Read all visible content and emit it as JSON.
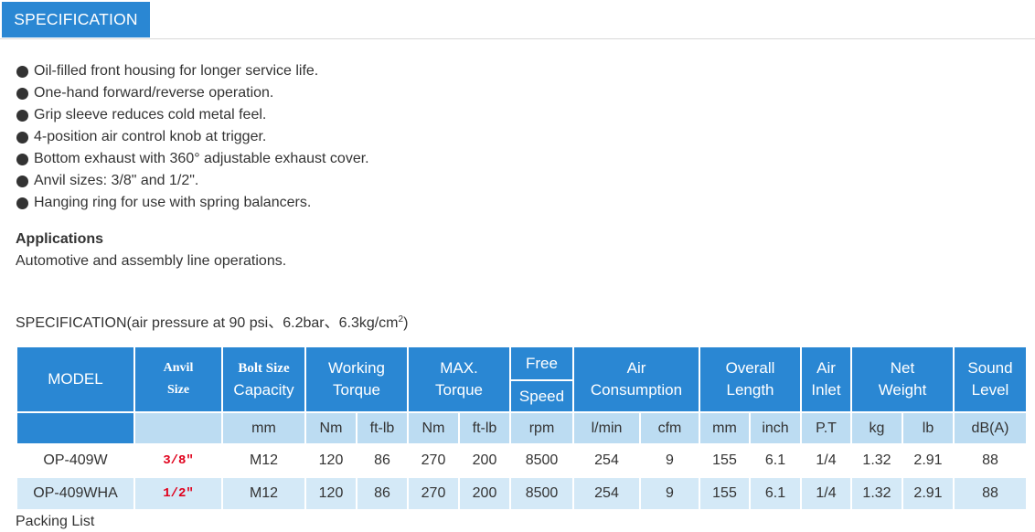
{
  "tab": {
    "label": "SPECIFICATION"
  },
  "features": [
    "Oil-filled front housing for longer service life.",
    "One-hand forward/reverse operation.",
    "Grip sleeve reduces cold metal feel.",
    "4-position air control knob at trigger.",
    "Bottom exhaust with 360° adjustable exhaust cover.",
    "Anvil sizes: 3/8\" and 1/2\".",
    "Hanging ring for use with spring balancers."
  ],
  "applications": {
    "title": "Applications",
    "text": "Automotive and assembly line operations."
  },
  "spec_caption": {
    "prefix": "SPECIFICATION(air pressure at 90 psi、6.2bar、6.3kg/cm",
    "sup": "2",
    "suffix": ")"
  },
  "table": {
    "headers": {
      "model": "MODEL",
      "anvil_1": "Anvil",
      "anvil_2": "Size",
      "bolt_1": "Bolt Size",
      "bolt_2": "Capacity",
      "working_1": "Working",
      "working_2": "Torque",
      "max_1": "MAX.",
      "max_2": "Torque",
      "free_1": "Free",
      "free_2": "Speed",
      "air_1": "Air",
      "air_2": "Consumption",
      "overall_1": "Overall",
      "overall_2": "Length",
      "inlet_1": "Air",
      "inlet_2": "Inlet",
      "net_1": "Net",
      "net_2": "Weight",
      "sound_1": "Sound",
      "sound_2": "Level"
    },
    "units": [
      "",
      "mm",
      "Nm",
      "ft-lb",
      "Nm",
      "ft-lb",
      "rpm",
      "l/min",
      "cfm",
      "mm",
      "inch",
      "P.T",
      "kg",
      "lb",
      "dB(A)"
    ],
    "rows": [
      [
        "OP-409W",
        "3/8\"",
        "M12",
        "120",
        "86",
        "270",
        "200",
        "8500",
        "254",
        "9",
        "155",
        "6.1",
        "1/4",
        "1.32",
        "2.91",
        "88"
      ],
      [
        "OP-409WHA",
        "1/2\"",
        "M12",
        "120",
        "86",
        "270",
        "200",
        "8500",
        "254",
        "9",
        "155",
        "6.1",
        "1/4",
        "1.32",
        "2.91",
        "88"
      ]
    ]
  },
  "bottom_text": "Packing List"
}
